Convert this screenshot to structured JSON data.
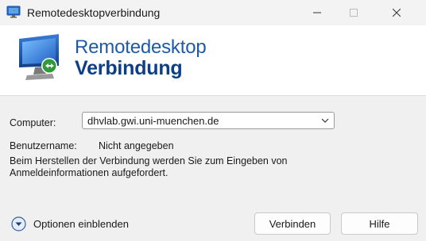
{
  "window": {
    "title": "Remotedesktopverbindung",
    "app_icon": "remote-desktop-icon",
    "controls": [
      "minimize-icon",
      "maximize-icon",
      "close-icon"
    ]
  },
  "banner": {
    "line1": "Remotedesktop",
    "line2": "Verbindung",
    "icon": "remote-desktop-monitor-icon",
    "colors": {
      "line1": "#1d5aa8",
      "line2": "#0c3f86"
    }
  },
  "form": {
    "computer_label": "Computer:",
    "computer_value": "dhvlab.gwi.uni-muenchen.de",
    "username_label": "Benutzername:",
    "username_value": "Nicht angegeben",
    "hint": "Beim Herstellen der Verbindung werden Sie zum Eingeben von Anmeldeinformationen aufgefordert."
  },
  "footer": {
    "options_label": "Optionen einblenden",
    "connect_label": "Verbinden",
    "help_label": "Hilfe"
  }
}
